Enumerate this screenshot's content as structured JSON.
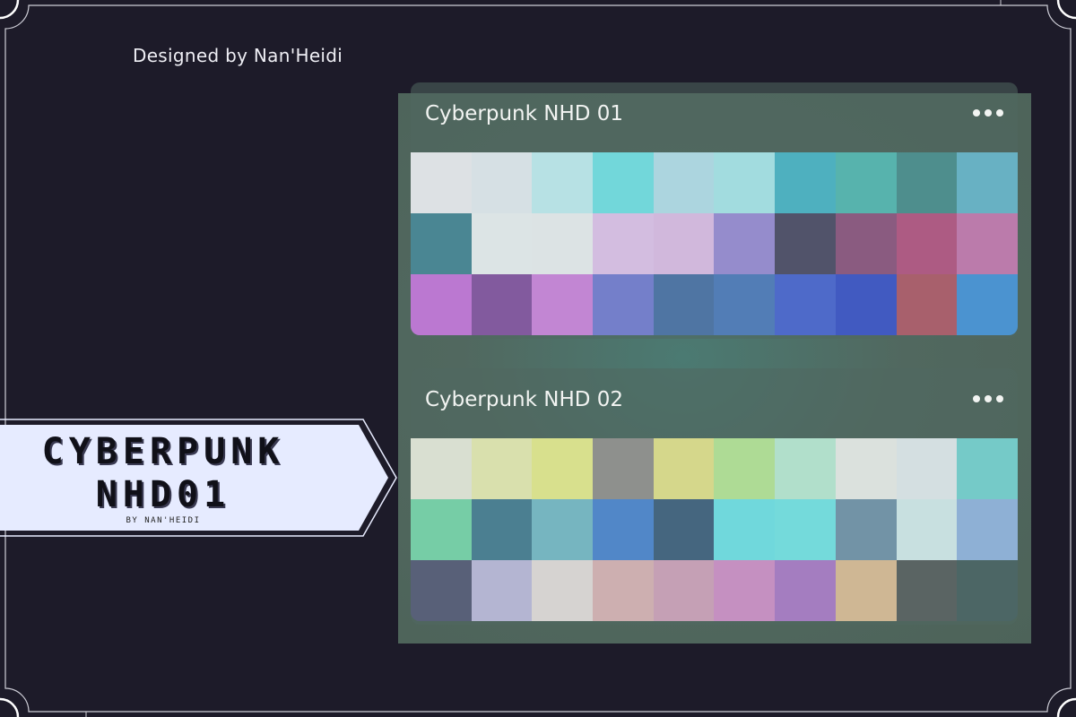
{
  "credit": "Designed by Nan'Heidi",
  "banner": {
    "title_line1": "CYBERPUNK",
    "title_line2": "NHD01",
    "subtitle": "BY NAN'HEIDI"
  },
  "palettes": [
    {
      "title": "Cyberpunk NHD 01",
      "menu_icon": "more-horizontal-icon",
      "swatches": [
        "#dde1e4",
        "#d6e0e4",
        "#b7e1e4",
        "#72d7da",
        "#acd5df",
        "#a2dcdf",
        "#4eb0bf",
        "#57b3ad",
        "#4e8e8d",
        "#68b1c3",
        "#4a8693",
        "#dce4e5",
        "#dce3e4",
        "#d3bde0",
        "#d1b8dc",
        "#958ccc",
        "#51536a",
        "#8a5b80",
        "#ad5b83",
        "#bb7bab",
        "#bb78d1",
        "#825a9e",
        "#c286d3",
        "#747fca",
        "#4f75a3",
        "#527db6",
        "#4e6ac9",
        "#415ac1",
        "#a8606c",
        "#4b93d0"
      ]
    },
    {
      "title": "Cyberpunk NHD 02",
      "menu_icon": "more-horizontal-icon",
      "swatches": [
        "#d9dfd1",
        "#d9e0ad",
        "#d8e08d",
        "#8e908d",
        "#d5d78b",
        "#aedb95",
        "#b1dfcb",
        "#dbe1dd",
        "#d4dfe1",
        "#75cac8",
        "#76cda6",
        "#4b7f91",
        "#76b5c0",
        "#5187c8",
        "#45667f",
        "#70d8dc",
        "#74dadb",
        "#7293a6",
        "#c8e0e0",
        "#8eb0d5",
        "#586078",
        "#b4b5d2",
        "#d6d3d1",
        "#cdafb0",
        "#c5a0b5",
        "#c590c1",
        "#a47dc0",
        "#cfb794",
        "#5a6463",
        "#4c6665"
      ]
    }
  ]
}
